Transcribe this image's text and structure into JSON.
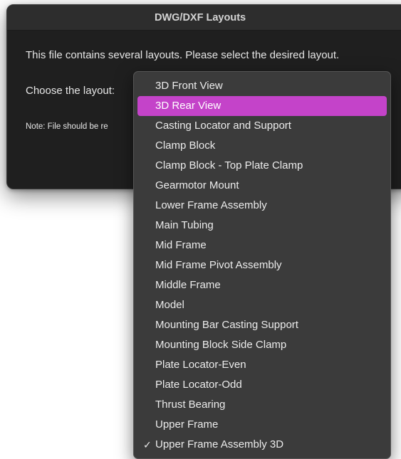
{
  "dialog": {
    "title": "DWG/DXF Layouts",
    "message": "This file contains several layouts. Please select the desired layout.",
    "choose_label": "Choose the layout:",
    "note": "Note: File should be re"
  },
  "dropdown": {
    "highlighted_index": 1,
    "checked_index": 18,
    "highlight_color": "#c443c9",
    "items": [
      {
        "label": "3D Front View"
      },
      {
        "label": "3D Rear View"
      },
      {
        "label": "Casting Locator and Support"
      },
      {
        "label": "Clamp Block"
      },
      {
        "label": "Clamp Block - Top Plate Clamp"
      },
      {
        "label": "Gearmotor Mount"
      },
      {
        "label": "Lower Frame Assembly"
      },
      {
        "label": "Main Tubing"
      },
      {
        "label": "Mid Frame"
      },
      {
        "label": "Mid Frame Pivot Assembly"
      },
      {
        "label": "Middle Frame"
      },
      {
        "label": "Model"
      },
      {
        "label": "Mounting Bar Casting Support"
      },
      {
        "label": "Mounting Block Side Clamp"
      },
      {
        "label": "Plate Locator-Even"
      },
      {
        "label": "Plate Locator-Odd"
      },
      {
        "label": "Thrust Bearing"
      },
      {
        "label": "Upper Frame"
      },
      {
        "label": "Upper Frame Assembly 3D"
      }
    ]
  }
}
